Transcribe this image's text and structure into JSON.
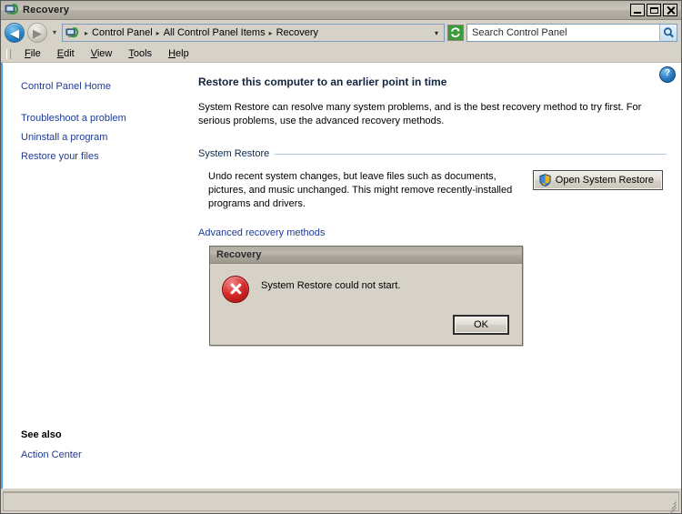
{
  "window": {
    "title": "Recovery",
    "icon": "recovery-app-icon",
    "controls": {
      "minimize": "minimize-button",
      "maximize": "maximize-button",
      "close": "close-button"
    }
  },
  "nav": {
    "back": "back-button",
    "forward": "forward-button",
    "history_caret": "▾",
    "breadcrumbs": [
      {
        "label": "Control Panel"
      },
      {
        "label": "All Control Panel Items"
      },
      {
        "label": "Recovery"
      }
    ],
    "separator": "▸",
    "address_caret": "▾",
    "refresh": "refresh-button"
  },
  "search": {
    "placeholder": "Search Control Panel",
    "value": "",
    "button": "search-button"
  },
  "menu": {
    "items": [
      {
        "accel": "F",
        "rest": "ile"
      },
      {
        "accel": "E",
        "rest": "dit"
      },
      {
        "accel": "V",
        "rest": "iew"
      },
      {
        "accel": "T",
        "rest": "ools"
      },
      {
        "accel": "H",
        "rest": "elp"
      }
    ]
  },
  "sidebar": {
    "home": "Control Panel Home",
    "links": [
      "Troubleshoot a problem",
      "Uninstall a program",
      "Restore your files"
    ],
    "see_also_heading": "See also",
    "see_also_links": [
      "Action Center"
    ]
  },
  "content": {
    "help_glyph": "?",
    "title": "Restore this computer to an earlier point in time",
    "intro": "System Restore can resolve many system problems, and is the best recovery method to try first. For serious problems, use the advanced recovery methods.",
    "group": {
      "legend": "System Restore",
      "description": "Undo recent system changes, but leave files such as documents, pictures, and music unchanged. This might remove recently-installed programs and drivers.",
      "button_label": "Open System Restore",
      "button_icon": "uac-shield-icon"
    },
    "advanced_link": "Advanced recovery methods"
  },
  "dialog": {
    "title": "Recovery",
    "icon": "error-icon",
    "message": "System Restore could not start.",
    "ok_label": "OK"
  },
  "statusbar": {
    "text": ""
  },
  "colors": {
    "window_chrome": "#d6d2c8",
    "link_blue": "#1f3a93",
    "accent_blue": "#4ba3e3",
    "error_red": "#d62a2a",
    "heading_navy": "#11253f"
  }
}
